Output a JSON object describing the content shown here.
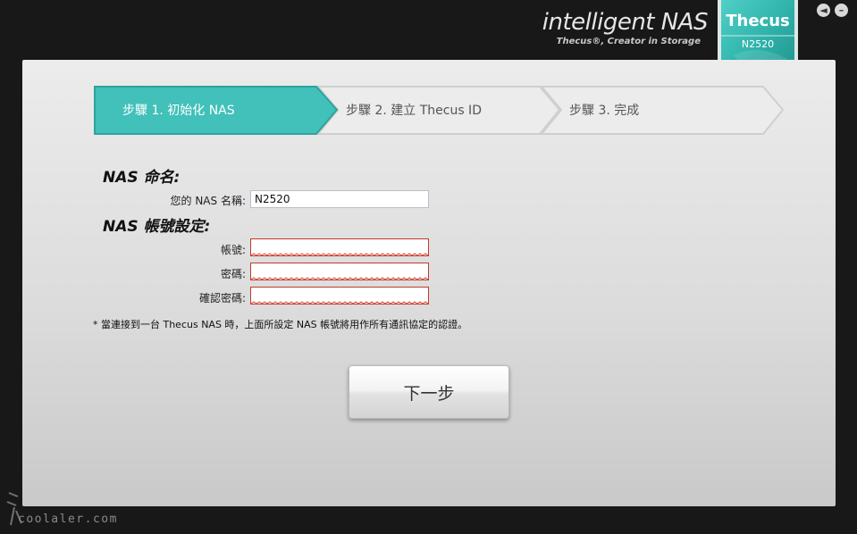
{
  "brand": {
    "title": "intelligent NAS",
    "subtitle": "Thecus®, Creator in Storage",
    "logo_text": "Thecus",
    "model": "N2520"
  },
  "window": {
    "back_icon": "arrow-left-icon",
    "minimize_icon": "minus-icon"
  },
  "steps": [
    {
      "label": "步驟 1. 初始化 NAS",
      "active": true
    },
    {
      "label": "步驟 2. 建立 Thecus ID",
      "active": false
    },
    {
      "label": "步驟 3. 完成",
      "active": false
    }
  ],
  "form": {
    "naming_title": "NAS 命名:",
    "name_label": "您的 NAS 名稱:",
    "name_value": "N2520",
    "account_title": "NAS 帳號設定:",
    "account_label": "帳號:",
    "account_value": "",
    "password_label": "密碼:",
    "password_value": "",
    "confirm_label": "確認密碼:",
    "confirm_value": "",
    "note": "* 當連接到一台 Thecus NAS 時，上面所設定 NAS 帳號將用作所有通訊協定的認證。"
  },
  "actions": {
    "next_label": "下一步"
  },
  "watermark": "coolaler.com",
  "colors": {
    "accent": "#3fbfb8",
    "accent_border": "#2fa39d",
    "error_border": "#c23b2a"
  }
}
